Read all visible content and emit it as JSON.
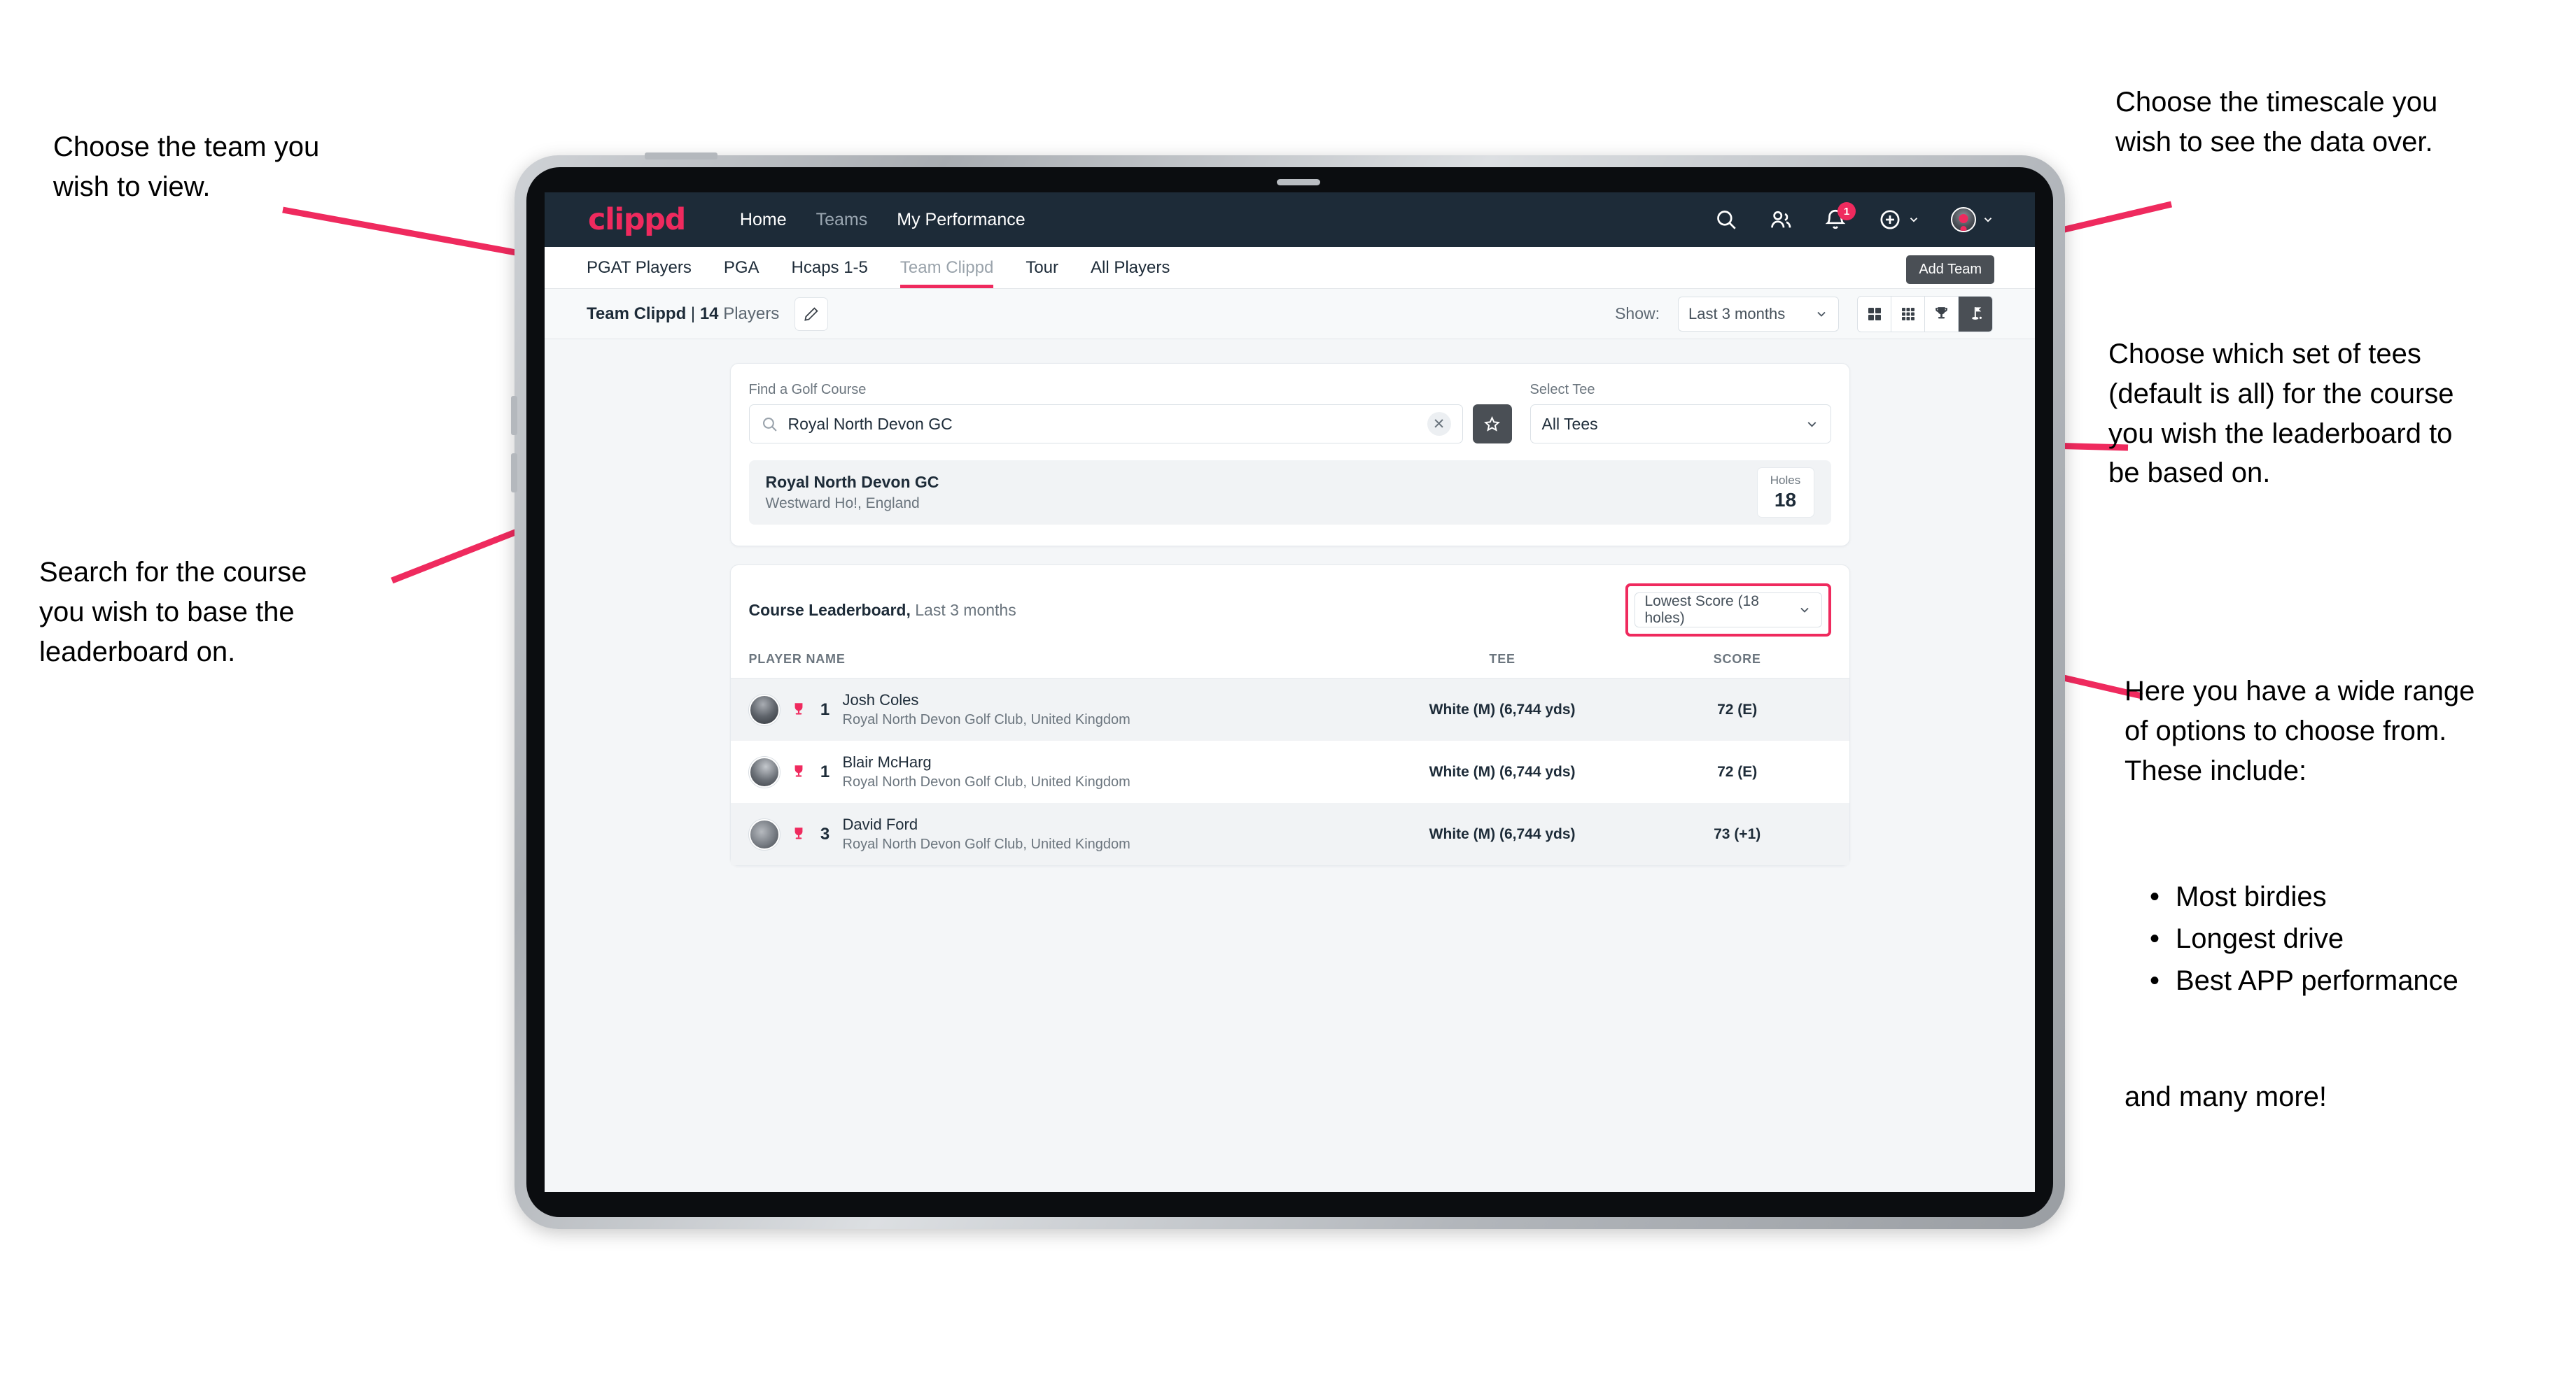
{
  "annotations": {
    "top_left": "Choose the team you\nwish to view.",
    "top_right": "Choose the timescale you\nwish to see the data over.",
    "mid_right": "Choose which set of tees\n(default is all) for the course\nyou wish the leaderboard to\nbe based on.",
    "mid_left": "Search for the course\nyou wish to base the\nleaderboard on.",
    "bottom_right_intro": "Here you have a wide range\nof options to choose from.\nThese include:",
    "bottom_right_bullets": [
      "Most birdies",
      "Longest drive",
      "Best APP performance"
    ],
    "bottom_right_outro": "and many more!"
  },
  "app": {
    "logo": "clippd",
    "nav": [
      {
        "label": "Home",
        "active": true
      },
      {
        "label": "Teams",
        "active": false
      },
      {
        "label": "My Performance",
        "active": true
      }
    ],
    "header_icons": [
      {
        "name": "search-icon"
      },
      {
        "name": "people-icon"
      },
      {
        "name": "bell-icon",
        "badge": "1"
      },
      {
        "name": "plus-circle-icon"
      },
      {
        "name": "avatar-icon"
      }
    ],
    "tooltip": "Add Team"
  },
  "tabs": [
    {
      "label": "PGAT Players",
      "state": "normal"
    },
    {
      "label": "PGA",
      "state": "normal"
    },
    {
      "label": "Hcaps 1-5",
      "state": "normal"
    },
    {
      "label": "Team Clippd",
      "state": "active"
    },
    {
      "label": "Tour",
      "state": "normal"
    },
    {
      "label": "All Players",
      "state": "normal"
    }
  ],
  "toolbar": {
    "team_name": "Team Clippd",
    "separator": "|",
    "player_count": "14",
    "players_word": "Players",
    "show_label": "Show:",
    "timescale_value": "Last 3 months",
    "view_buttons": [
      {
        "name": "grid-four-icon",
        "active": false
      },
      {
        "name": "grid-nine-icon",
        "active": false
      },
      {
        "name": "trophy-icon",
        "active": false
      },
      {
        "name": "golf-flag-icon",
        "active": true
      }
    ]
  },
  "search": {
    "course_label": "Find a Golf Course",
    "course_value": "Royal North Devon GC",
    "course_placeholder": "Find a Golf Course",
    "tee_label": "Select Tee",
    "tee_value": "All Tees"
  },
  "course_result": {
    "name": "Royal North Devon GC",
    "location": "Westward Ho!, England",
    "holes_label": "Holes",
    "holes_value": "18"
  },
  "leaderboard": {
    "title": "Course Leaderboard,",
    "subtitle": " Last 3 months",
    "metric_value": "Lowest Score (18 holes)",
    "columns": [
      "PLAYER NAME",
      "TEE",
      "SCORE"
    ],
    "rows": [
      {
        "rank": "1",
        "name": "Josh Coles",
        "club": "Royal North Devon Golf Club, United Kingdom",
        "tee": "White (M) (6,744 yds)",
        "score": "72 (E)"
      },
      {
        "rank": "1",
        "name": "Blair McHarg",
        "club": "Royal North Devon Golf Club, United Kingdom",
        "tee": "White (M) (6,744 yds)",
        "score": "72 (E)"
      },
      {
        "rank": "3",
        "name": "David Ford",
        "club": "Royal North Devon Golf Club, United Kingdom",
        "tee": "White (M) (6,744 yds)",
        "score": "73 (+1)"
      }
    ]
  },
  "colors": {
    "accent_pink": "#ef2a5e",
    "header_navy": "#1d2b38",
    "page_bg": "#f4f6f8",
    "dark_button": "#4a4f55"
  }
}
